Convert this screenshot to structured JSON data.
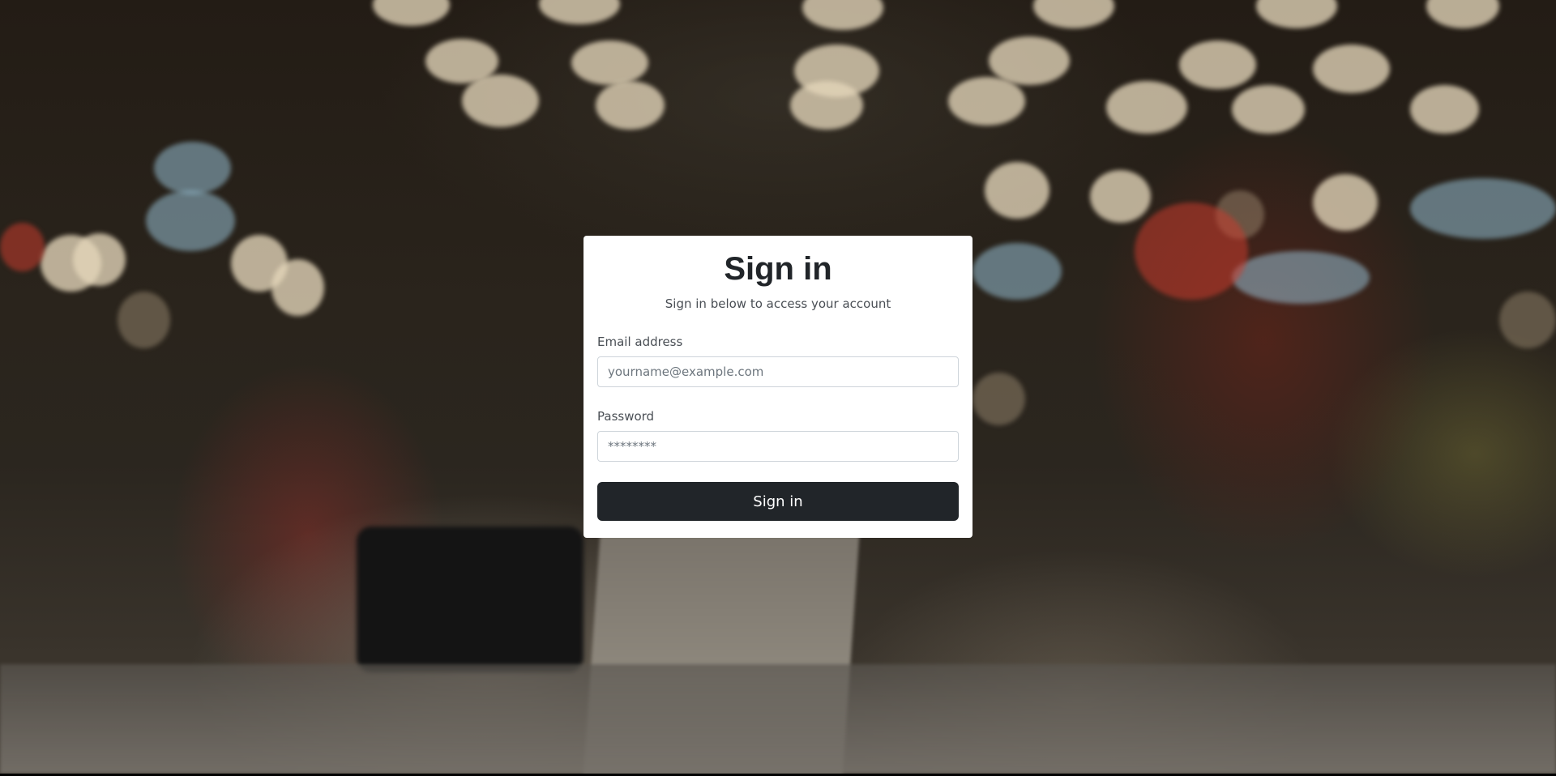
{
  "background": {
    "description_icon": "store-checkout-background"
  },
  "signin": {
    "title": "Sign in",
    "subtitle": "Sign in below to access your account",
    "email": {
      "label": "Email address",
      "placeholder": "yourname@example.com",
      "value": ""
    },
    "password": {
      "label": "Password",
      "placeholder": "********",
      "value": ""
    },
    "submit_label": "Sign in"
  },
  "colors": {
    "card_background": "#ffffff",
    "button_background": "#212529",
    "button_text": "#ffffff",
    "text_primary": "#212529",
    "text_secondary": "#4a4f55",
    "input_border": "#ced4da"
  }
}
